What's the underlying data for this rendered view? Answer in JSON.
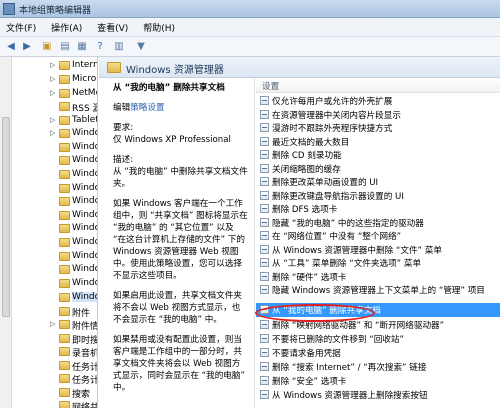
{
  "window": {
    "title": "本地组策略编辑器"
  },
  "menu": [
    "文件(F)",
    "操作(A)",
    "查看(V)",
    "帮助(H)"
  ],
  "toolbar": {
    "icons": [
      "back-icon",
      "forward-icon",
      "folder-up-icon",
      "show-hide-tree-icon",
      "export-icon",
      "help-icon",
      "properties-icon",
      "filter-icon"
    ]
  },
  "tree": {
    "items": [
      "Intern",
      "Micro",
      "NetMe",
      "RSS 源",
      "Tablet",
      "Windo",
      "Windo",
      "Windo",
      "Windo",
      "Windo",
      "Windo",
      "Windo",
      "Windo",
      "Windo",
      "Windo",
      "Windo",
      "Windo",
      "Windo",
      "附件",
      "附件情",
      "即时搜",
      "录音机",
      "任务计",
      "任务计",
      "搜索",
      "网络共"
    ]
  },
  "content": {
    "header": "Windows 资源管理器"
  },
  "description": {
    "title": "从 “我的电脑” 删除共享文档",
    "edit_prefix": "编辑",
    "edit_link": "策略设置",
    "req_label": "要求:",
    "req_value": "仅 Windows XP Professional",
    "desc_label": "描述:",
    "desc_text": "从 “我的电脑” 中删除共享文档文件夹。",
    "para1": "如果 Windows 客户端在一个工作组中，则 “共享文档” 图标将显示在 “我的电脑” 的 “其它位置” 以及 “在这台计算机上存储的文件” 下的 Windows 资源管理器 Web 视图中。使用此策略设置，您可以选择不显示这些项目。",
    "para2": "如果启用此设置，共享文档文件夹将不会以 Web 视图方式显示，也不会显示在 “我的电脑” 中。",
    "para3": "如果禁用或没有配置此设置，则当客户端是工作组中的一部分时，共享文档文件夹将会以 Web 视图方式显示，同时会显示在 “我的电脑” 中。"
  },
  "list": {
    "column_header": "设置",
    "items": [
      "仅允许每用户或允许的外壳扩展",
      "在资源管理器中关闭内容片段显示",
      "漫游时不跟踪外壳程序快捷方式",
      "最近文档的最大数目",
      "删除 CD 刻录功能",
      "关闭缩略图的缓存",
      "删除更改菜单动画设置的 UI",
      "删除更改键盘导航指示器设置的 UI",
      "删除 DFS 选项卡",
      "隐藏 “我的电脑” 中的这些指定的驱动器",
      "在 “网络位置” 中没有 “整个网络”",
      "从 Windows 资源管理器中删除 “文件” 菜单",
      "从 “工具” 菜单删除 “文件夹选项” 菜单",
      "删除 “硬件” 选项卡",
      "隐藏 Windows 资源管理器上下文菜单上的 “管理” 项目",
      "从 “我的电脑” 删除共享文档",
      "删除 “映射网络驱动器” 和 “断开网络驱动器”",
      "不要将已删除的文件移到 “回收站”",
      "不要请求备用凭据",
      "删除 “搜索 Internet” / “再次搜索” 链接",
      "删除 “安全” 选项卡",
      "从 Windows 资源管理器上删除搜索按钮"
    ],
    "selected_index": 15
  }
}
